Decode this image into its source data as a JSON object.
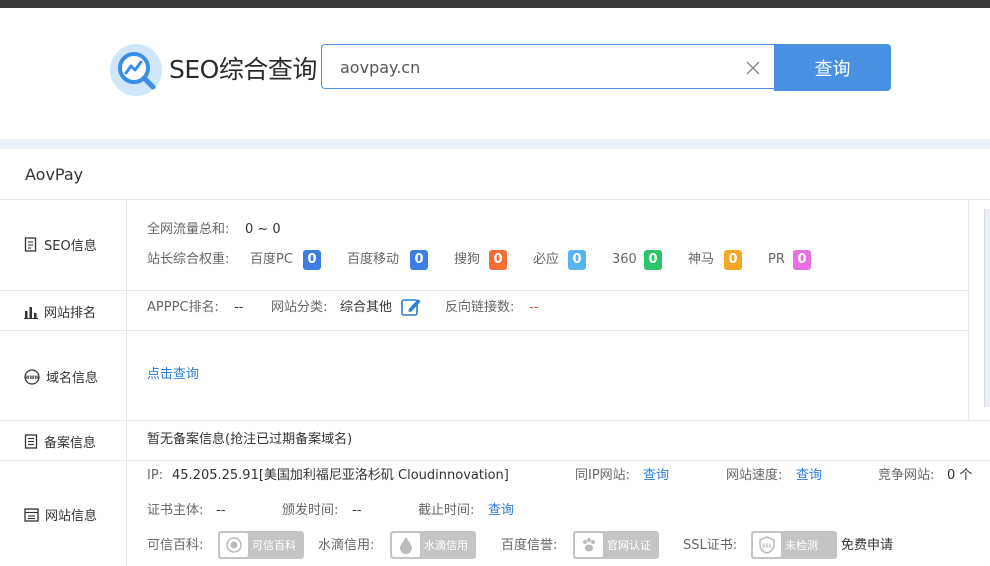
{
  "header": {
    "logo_text": "SEO综合查询",
    "search_value": "aovpay.cn",
    "search_button": "查询"
  },
  "site": {
    "name": "AovPay"
  },
  "seo": {
    "label": "SEO信息",
    "traffic_label": "全网流量总和:",
    "traffic_value": "0 ~ 0",
    "weight_label": "站长综合权重:",
    "engines": [
      {
        "name": "百度PC",
        "value": "0",
        "color": "#3d7fe0"
      },
      {
        "name": "百度移动",
        "value": "0",
        "color": "#3d7fe0"
      },
      {
        "name": "搜狗",
        "value": "0",
        "color": "#f46d36"
      },
      {
        "name": "必应",
        "value": "0",
        "color": "#58b4ef"
      },
      {
        "name": "360",
        "value": "0",
        "color": "#2dc56a"
      },
      {
        "name": "神马",
        "value": "0",
        "color": "#f5a623"
      },
      {
        "name": "PR",
        "value": "0",
        "color": "#e870e0"
      }
    ]
  },
  "rank": {
    "label": "网站排名",
    "apppc_label": "APPPC排名:",
    "apppc_value": "--",
    "category_label": "网站分类:",
    "category_value": "综合其他",
    "backlinks_label": "反向链接数:",
    "backlinks_value": "--"
  },
  "domain": {
    "label": "域名信息",
    "query_link": "点击查询"
  },
  "icp": {
    "label": "备案信息",
    "value": "暂无备案信息(抢注已过期备案域名)"
  },
  "webinfo": {
    "label": "网站信息",
    "ip_label": "IP:",
    "ip_value": "45.205.25.91[美国加利福尼亚洛杉矶 Cloudinnovation]",
    "same_ip_label": "同IP网站:",
    "same_ip_link": "查询",
    "speed_label": "网站速度:",
    "speed_link": "查询",
    "compete_label": "竞争网站:",
    "compete_value": "0 个",
    "cert_subject_label": "证书主体:",
    "cert_subject_value": "--",
    "issue_label": "颁发时间:",
    "issue_value": "--",
    "expire_label": "截止时间:",
    "expire_link": "查询",
    "trust_label": "可信百科:",
    "trust_badge": "可信百科",
    "water_label": "水滴信用:",
    "water_badge": "水滴信用",
    "baidu_label": "百度信誉:",
    "baidu_badge": "官网认证",
    "ssl_label": "SSL证书:",
    "ssl_badge": "未检测",
    "free_apply": "免费申请"
  }
}
